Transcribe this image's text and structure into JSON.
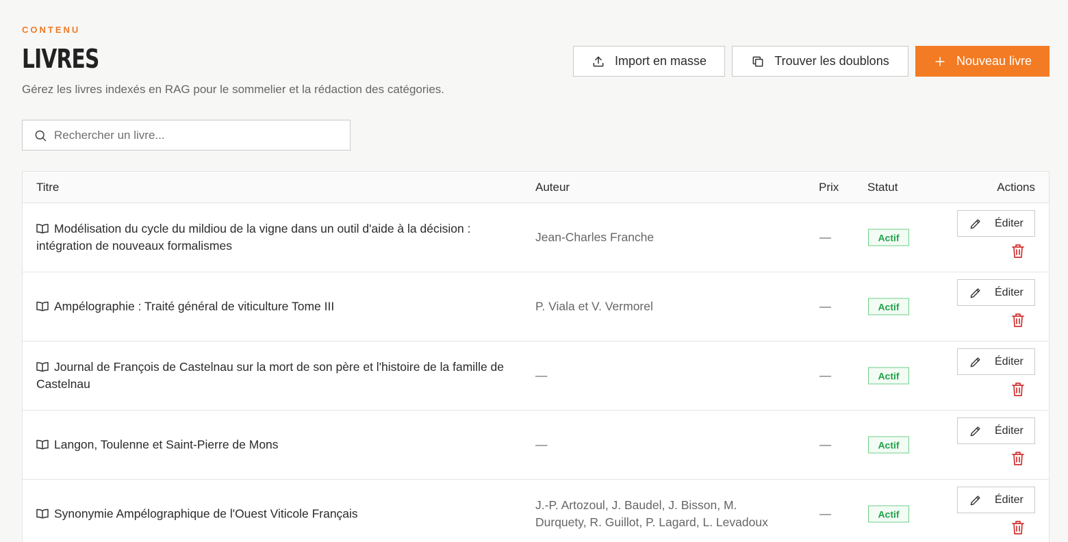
{
  "header": {
    "eyebrow": "CONTENU",
    "title": "LIVRES",
    "subtitle": "Gérez les livres indexés en RAG pour le sommelier et la rédaction des catégories."
  },
  "toolbar": {
    "import_label": "Import en masse",
    "duplicates_label": "Trouver les doublons",
    "new_label": "Nouveau livre"
  },
  "search": {
    "placeholder": "Rechercher un livre...",
    "value": ""
  },
  "table": {
    "columns": {
      "title": "Titre",
      "author": "Auteur",
      "price": "Prix",
      "status": "Statut",
      "actions": "Actions"
    },
    "edit_label": "Éditer",
    "rows": [
      {
        "title": "Modélisation du cycle du mildiou de la vigne dans un outil d'aide à la décision : intégration de nouveaux formalismes",
        "author": "Jean-Charles Franche",
        "price": "—",
        "status": "Actif"
      },
      {
        "title": "Ampélographie : Traité général de viticulture Tome III",
        "author": "P. Viala et V. Vermorel",
        "price": "—",
        "status": "Actif"
      },
      {
        "title": "Journal de François de Castelnau sur la mort de son père et l'histoire de la famille de Castelnau",
        "author": "—",
        "price": "—",
        "status": "Actif"
      },
      {
        "title": "Langon, Toulenne et Saint-Pierre de Mons",
        "author": "—",
        "price": "—",
        "status": "Actif"
      },
      {
        "title": "Synonymie Ampélographique de l'Ouest Viticole Français",
        "author": "J.-P. Artozoul, J. Baudel, J. Bisson, M. Durquety, R. Guillot, P. Lagard, L. Levadoux",
        "price": "—",
        "status": "Actif"
      }
    ]
  },
  "colors": {
    "accent": "#f37b23",
    "status_active": "#22a04a",
    "danger": "#d32f2f"
  }
}
